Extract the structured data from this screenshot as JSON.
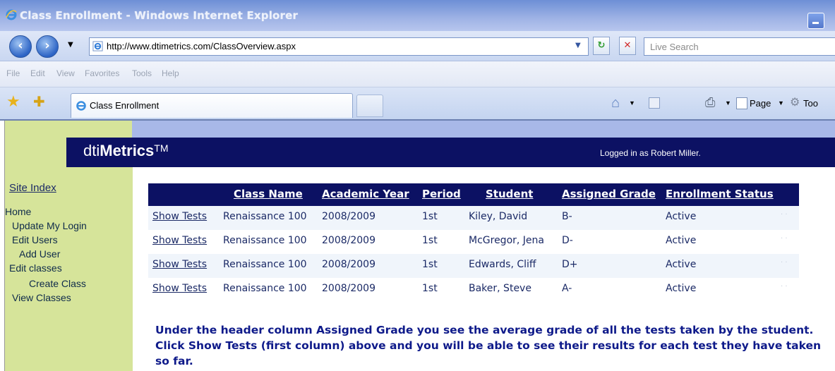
{
  "window": {
    "title": "Class Enrollment - Windows Internet Explorer"
  },
  "address_bar": {
    "url": "http://www.dtimetrics.com/ClassOverview.aspx",
    "search_placeholder": "Live Search"
  },
  "menu": [
    "File",
    "Edit",
    "View",
    "Favorites",
    "Tools",
    "Help"
  ],
  "tabs": {
    "active_label": "Class Enrollment"
  },
  "command_bar": {
    "page_label": "Page",
    "tools_label": "Too"
  },
  "sidebar": {
    "site_index": "Site Index",
    "items": [
      {
        "label": "Home"
      },
      {
        "label": "Update My Login"
      },
      {
        "label": "Edit Users"
      },
      {
        "label": "Add User"
      },
      {
        "label": "Edit classes"
      },
      {
        "label": "Create Class"
      },
      {
        "label": "View Classes"
      }
    ]
  },
  "banner": {
    "logo_prefix": "dti",
    "logo_bold": "Metrics",
    "logo_tm": "TM",
    "logged_in": "Logged in as Robert Miller."
  },
  "table": {
    "headers": [
      "Class Name",
      "Academic Year",
      "Period",
      "Student",
      "Assigned Grade",
      "Enrollment Status"
    ],
    "rows": [
      {
        "action": "Show Tests",
        "class": "Renaissance 100",
        "year": "2008/2009",
        "period": "1st",
        "student": "Kiley, David",
        "grade": "B-",
        "status": "Active"
      },
      {
        "action": "Show Tests",
        "class": "Renaissance 100",
        "year": "2008/2009",
        "period": "1st",
        "student": "McGregor, Jena",
        "grade": "D-",
        "status": "Active"
      },
      {
        "action": "Show Tests",
        "class": "Renaissance 100",
        "year": "2008/2009",
        "period": "1st",
        "student": "Edwards, Cliff",
        "grade": "D+",
        "status": "Active"
      },
      {
        "action": "Show Tests",
        "class": "Renaissance 100",
        "year": "2008/2009",
        "period": "1st",
        "student": "Baker, Steve",
        "grade": "A-",
        "status": "Active"
      }
    ]
  },
  "note": "Under the header column Assigned Grade you see the average grade of all the tests taken by the student. Click Show Tests (first column) above and you will be able to see their results for each test they have taken so far."
}
